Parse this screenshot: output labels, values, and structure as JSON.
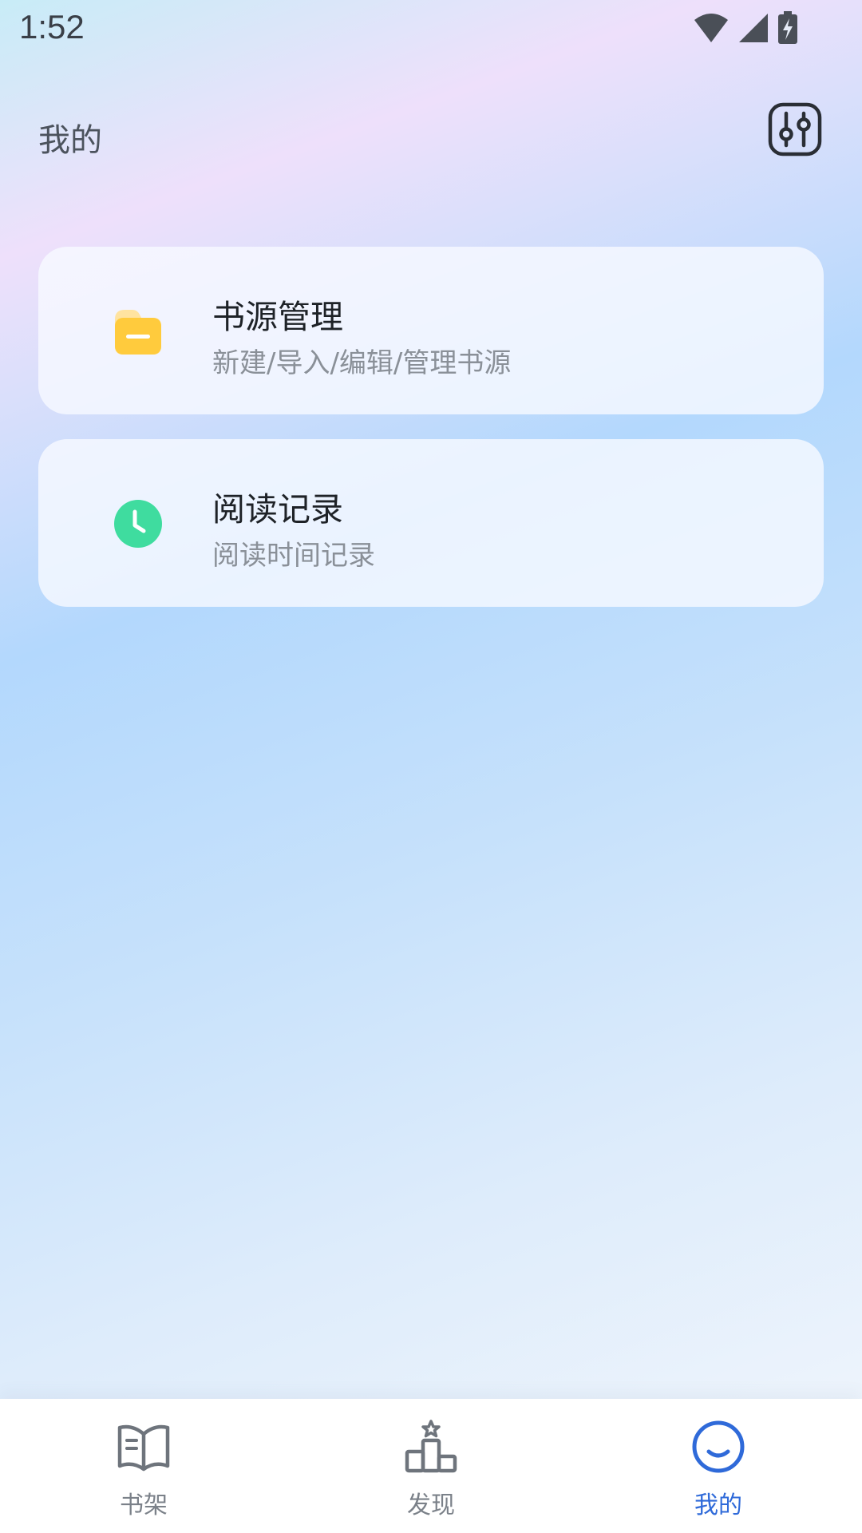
{
  "status_bar": {
    "time": "1:52",
    "icons": [
      "wifi-icon",
      "signal-icon",
      "battery-charging-icon"
    ]
  },
  "header": {
    "title": "我的",
    "settings_icon": "sliders-icon"
  },
  "cards": [
    {
      "icon": "folder-icon",
      "icon_color": "#ffcb3d",
      "title": "书源管理",
      "subtitle": "新建/导入/编辑/管理书源"
    },
    {
      "icon": "clock-icon",
      "icon_color": "#3fdc9f",
      "title": "阅读记录",
      "subtitle": "阅读时间记录"
    }
  ],
  "tab_bar": {
    "active": "我的",
    "accent_color": "#2f6ad9",
    "tabs": [
      {
        "label": "书架",
        "icon": "book-icon"
      },
      {
        "label": "发现",
        "icon": "podium-star-icon"
      },
      {
        "label": "我的",
        "icon": "smile-icon"
      }
    ]
  }
}
